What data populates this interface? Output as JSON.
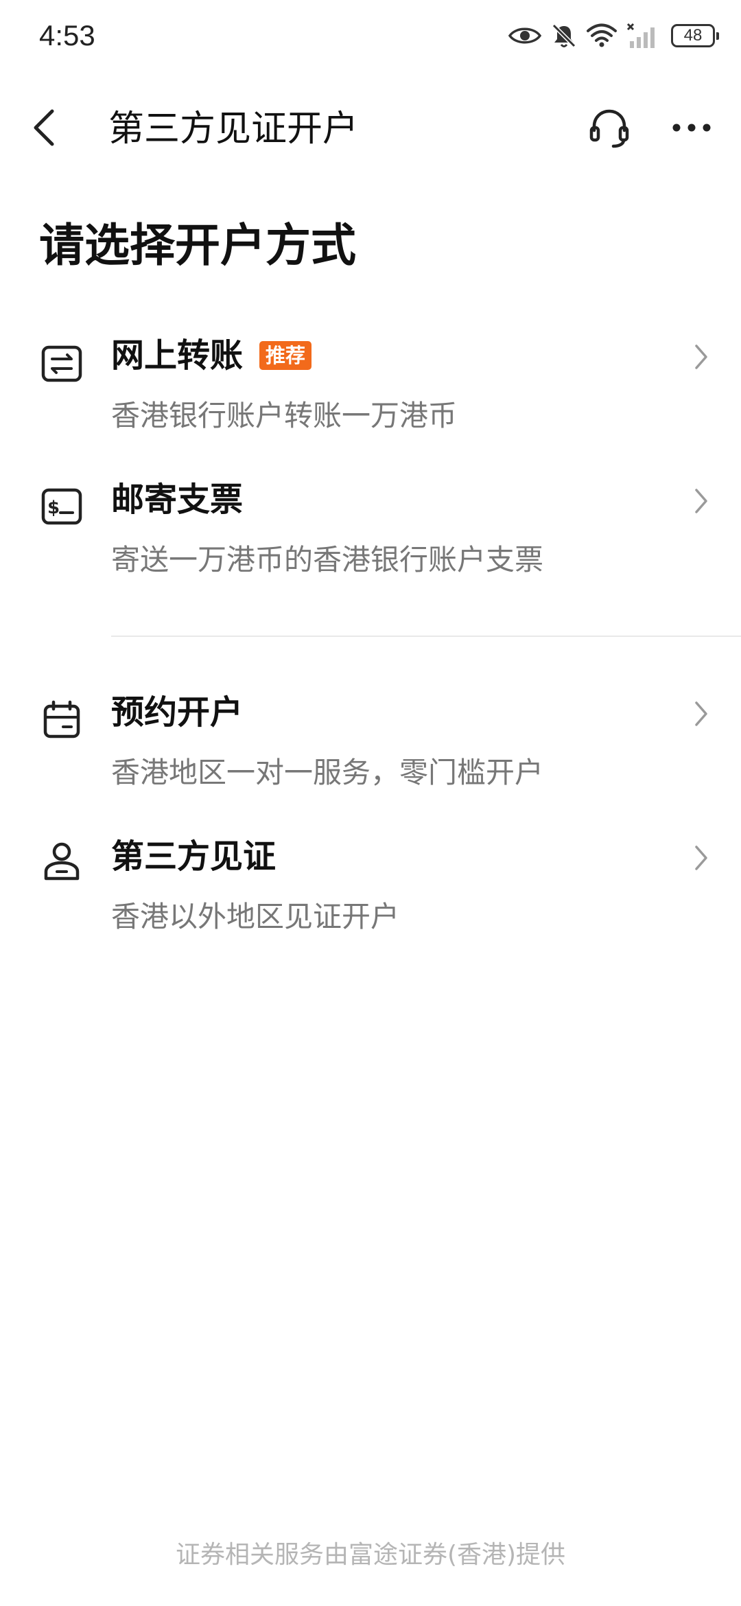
{
  "status_bar": {
    "time": "4:53",
    "battery": "48",
    "icons": [
      "eye-icon",
      "bell-off-icon",
      "wifi-icon",
      "signal-off-icon",
      "battery-icon"
    ]
  },
  "nav": {
    "title": "第三方见证开户",
    "left_icon": "chevron-left-icon",
    "right_icons": [
      "headset-icon",
      "more-horizontal-icon"
    ]
  },
  "heading": "请选择开户方式",
  "options": [
    {
      "title": "网上转账",
      "badge": "推荐",
      "desc": "香港银行账户转账一万港币",
      "icon": "transfer-icon"
    },
    {
      "title": "邮寄支票",
      "desc": "寄送一万港币的香港银行账户支票",
      "icon": "cheque-icon"
    },
    {
      "title": "预约开户",
      "desc": "香港地区一对一服务，零门槛开户",
      "icon": "calendar-icon"
    },
    {
      "title": "第三方见证",
      "desc": "香港以外地区见证开户",
      "icon": "person-icon"
    }
  ],
  "footer": "证券相关服务由富途证券(香港)提供",
  "colors": {
    "badge": "#f26a1b",
    "text_primary": "#111111",
    "text_secondary": "#777777",
    "footer": "#b5b5b5"
  }
}
